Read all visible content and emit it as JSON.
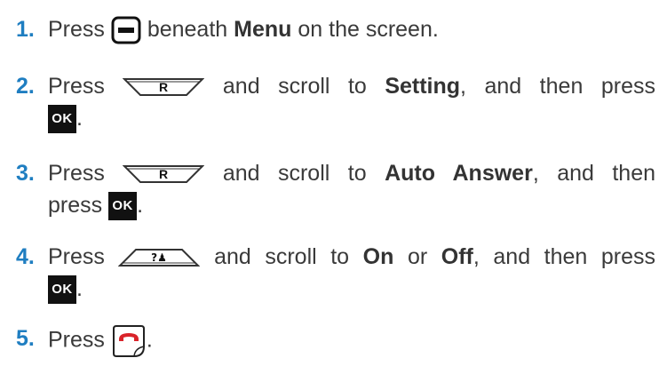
{
  "steps": [
    {
      "number": "1.",
      "press": "Press",
      "text_after_icon": "beneath",
      "bold1": "Menu",
      "text_end": "on the screen."
    },
    {
      "number": "2.",
      "press": "Press",
      "icon_label": "R",
      "text_mid": "and scroll to",
      "bold1": "Setting",
      "text_end": ", and then press",
      "ok_label": "OK",
      "tail": "."
    },
    {
      "number": "3.",
      "press": "Press",
      "icon_label": "R",
      "text_mid": "and scroll to",
      "bold1": "Auto Answer",
      "text_end": ", and then",
      "press2": "press",
      "ok_label": "OK",
      "tail": "."
    },
    {
      "number": "4.",
      "press": "Press",
      "icon_label": "?♟",
      "text_mid": "and scroll to",
      "bold1": "On",
      "text_or": "or",
      "bold2": "Off",
      "text_end": ", and then press",
      "ok_label": "OK",
      "tail": "."
    },
    {
      "number": "5.",
      "press": "Press",
      "tail": "."
    }
  ],
  "colors": {
    "step_number": "#1f7ec1",
    "end_call_red": "#d9232a",
    "text": "#3a3a3a"
  },
  "icons": {
    "menu_softkey": "minus-softkey-icon",
    "down_nav": "nav-down-r-icon",
    "up_nav": "nav-up-contacts-icon",
    "ok_key": "ok-key-icon",
    "end_call": "end-call-icon"
  }
}
